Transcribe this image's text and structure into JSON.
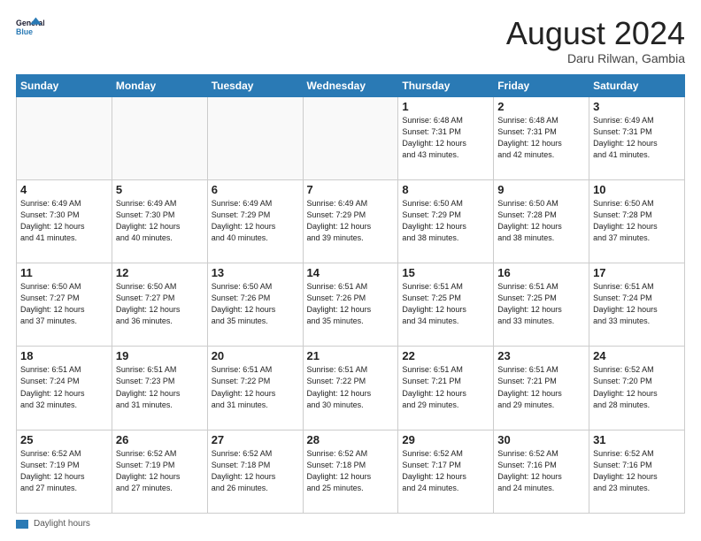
{
  "logo": {
    "line1": "General",
    "line2": "Blue"
  },
  "header": {
    "month_year": "August 2024",
    "location": "Daru Rilwan, Gambia"
  },
  "weekdays": [
    "Sunday",
    "Monday",
    "Tuesday",
    "Wednesday",
    "Thursday",
    "Friday",
    "Saturday"
  ],
  "footer": {
    "label": "Daylight hours"
  },
  "weeks": [
    [
      {
        "day": "",
        "info": ""
      },
      {
        "day": "",
        "info": ""
      },
      {
        "day": "",
        "info": ""
      },
      {
        "day": "",
        "info": ""
      },
      {
        "day": "1",
        "info": "Sunrise: 6:48 AM\nSunset: 7:31 PM\nDaylight: 12 hours\nand 43 minutes."
      },
      {
        "day": "2",
        "info": "Sunrise: 6:48 AM\nSunset: 7:31 PM\nDaylight: 12 hours\nand 42 minutes."
      },
      {
        "day": "3",
        "info": "Sunrise: 6:49 AM\nSunset: 7:31 PM\nDaylight: 12 hours\nand 41 minutes."
      }
    ],
    [
      {
        "day": "4",
        "info": "Sunrise: 6:49 AM\nSunset: 7:30 PM\nDaylight: 12 hours\nand 41 minutes."
      },
      {
        "day": "5",
        "info": "Sunrise: 6:49 AM\nSunset: 7:30 PM\nDaylight: 12 hours\nand 40 minutes."
      },
      {
        "day": "6",
        "info": "Sunrise: 6:49 AM\nSunset: 7:29 PM\nDaylight: 12 hours\nand 40 minutes."
      },
      {
        "day": "7",
        "info": "Sunrise: 6:49 AM\nSunset: 7:29 PM\nDaylight: 12 hours\nand 39 minutes."
      },
      {
        "day": "8",
        "info": "Sunrise: 6:50 AM\nSunset: 7:29 PM\nDaylight: 12 hours\nand 38 minutes."
      },
      {
        "day": "9",
        "info": "Sunrise: 6:50 AM\nSunset: 7:28 PM\nDaylight: 12 hours\nand 38 minutes."
      },
      {
        "day": "10",
        "info": "Sunrise: 6:50 AM\nSunset: 7:28 PM\nDaylight: 12 hours\nand 37 minutes."
      }
    ],
    [
      {
        "day": "11",
        "info": "Sunrise: 6:50 AM\nSunset: 7:27 PM\nDaylight: 12 hours\nand 37 minutes."
      },
      {
        "day": "12",
        "info": "Sunrise: 6:50 AM\nSunset: 7:27 PM\nDaylight: 12 hours\nand 36 minutes."
      },
      {
        "day": "13",
        "info": "Sunrise: 6:50 AM\nSunset: 7:26 PM\nDaylight: 12 hours\nand 35 minutes."
      },
      {
        "day": "14",
        "info": "Sunrise: 6:51 AM\nSunset: 7:26 PM\nDaylight: 12 hours\nand 35 minutes."
      },
      {
        "day": "15",
        "info": "Sunrise: 6:51 AM\nSunset: 7:25 PM\nDaylight: 12 hours\nand 34 minutes."
      },
      {
        "day": "16",
        "info": "Sunrise: 6:51 AM\nSunset: 7:25 PM\nDaylight: 12 hours\nand 33 minutes."
      },
      {
        "day": "17",
        "info": "Sunrise: 6:51 AM\nSunset: 7:24 PM\nDaylight: 12 hours\nand 33 minutes."
      }
    ],
    [
      {
        "day": "18",
        "info": "Sunrise: 6:51 AM\nSunset: 7:24 PM\nDaylight: 12 hours\nand 32 minutes."
      },
      {
        "day": "19",
        "info": "Sunrise: 6:51 AM\nSunset: 7:23 PM\nDaylight: 12 hours\nand 31 minutes."
      },
      {
        "day": "20",
        "info": "Sunrise: 6:51 AM\nSunset: 7:22 PM\nDaylight: 12 hours\nand 31 minutes."
      },
      {
        "day": "21",
        "info": "Sunrise: 6:51 AM\nSunset: 7:22 PM\nDaylight: 12 hours\nand 30 minutes."
      },
      {
        "day": "22",
        "info": "Sunrise: 6:51 AM\nSunset: 7:21 PM\nDaylight: 12 hours\nand 29 minutes."
      },
      {
        "day": "23",
        "info": "Sunrise: 6:51 AM\nSunset: 7:21 PM\nDaylight: 12 hours\nand 29 minutes."
      },
      {
        "day": "24",
        "info": "Sunrise: 6:52 AM\nSunset: 7:20 PM\nDaylight: 12 hours\nand 28 minutes."
      }
    ],
    [
      {
        "day": "25",
        "info": "Sunrise: 6:52 AM\nSunset: 7:19 PM\nDaylight: 12 hours\nand 27 minutes."
      },
      {
        "day": "26",
        "info": "Sunrise: 6:52 AM\nSunset: 7:19 PM\nDaylight: 12 hours\nand 27 minutes."
      },
      {
        "day": "27",
        "info": "Sunrise: 6:52 AM\nSunset: 7:18 PM\nDaylight: 12 hours\nand 26 minutes."
      },
      {
        "day": "28",
        "info": "Sunrise: 6:52 AM\nSunset: 7:18 PM\nDaylight: 12 hours\nand 25 minutes."
      },
      {
        "day": "29",
        "info": "Sunrise: 6:52 AM\nSunset: 7:17 PM\nDaylight: 12 hours\nand 24 minutes."
      },
      {
        "day": "30",
        "info": "Sunrise: 6:52 AM\nSunset: 7:16 PM\nDaylight: 12 hours\nand 24 minutes."
      },
      {
        "day": "31",
        "info": "Sunrise: 6:52 AM\nSunset: 7:16 PM\nDaylight: 12 hours\nand 23 minutes."
      }
    ]
  ]
}
